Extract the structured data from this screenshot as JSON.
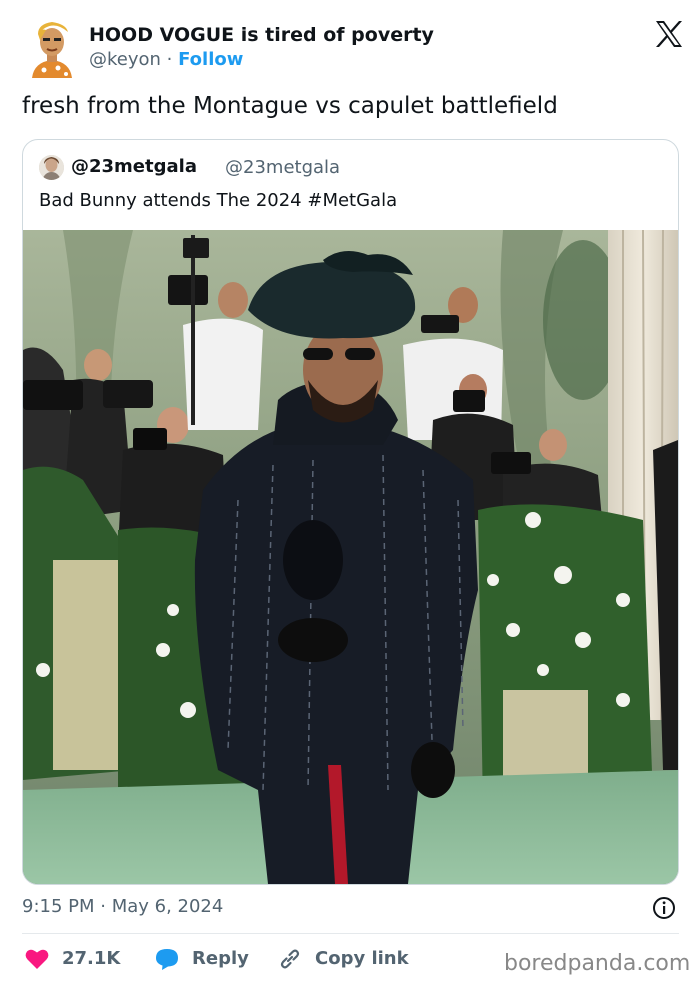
{
  "author": {
    "display_name": "HOOD VOGUE is tired of poverty",
    "handle": "@keyon",
    "separator": " · ",
    "follow_label": "Follow",
    "avatar_icon": "cartoon-avatar-icon"
  },
  "platform_icon": "x-logo-icon",
  "tweet": {
    "text": "fresh from the Montague vs capulet battlefield"
  },
  "quoted_tweet": {
    "display_name": "@23metgala",
    "handle": "@23metgala",
    "text": "Bad Bunny attends The 2024 #MetGala",
    "media": "photo-man-in-black-suit-and-hat-met-gala-carpet"
  },
  "timestamp": "9:15 PM · May 6, 2024",
  "actions": {
    "like_count": "27.1K",
    "reply_label": "Reply",
    "copy_label": "Copy link"
  },
  "watermark": "boredpanda.com",
  "colors": {
    "accent": "#1d9bf0",
    "like": "#f91880",
    "muted": "#536471",
    "carpet": "#8fb89a"
  }
}
